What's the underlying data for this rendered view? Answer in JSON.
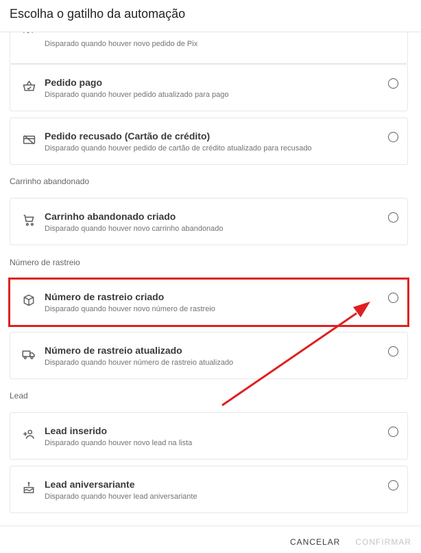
{
  "dialog": {
    "title": "Escolha o gatilho da automação"
  },
  "items": {
    "pix": {
      "description": "Disparado quando houver novo pedido de Pix"
    },
    "pedido_pago": {
      "title": "Pedido pago",
      "description": "Disparado quando houver pedido atualizado para pago"
    },
    "pedido_recusado": {
      "title": "Pedido recusado (Cartão de crédito)",
      "description": "Disparado quando houver pedido de cartão de crédito atualizado para recusado"
    },
    "carrinho_abandonado": {
      "title": "Carrinho abandonado criado",
      "description": "Disparado quando houver novo carrinho abandonado"
    },
    "rastreio_criado": {
      "title": "Número de rastreio criado",
      "description": "Disparado quando houver novo número de rastreio"
    },
    "rastreio_atualizado": {
      "title": "Número de rastreio atualizado",
      "description": "Disparado quando houver número de rastreio atualizado"
    },
    "lead_inserido": {
      "title": "Lead inserido",
      "description": "Disparado quando houver novo lead na lista"
    },
    "lead_aniversariante": {
      "title": "Lead aniversariante",
      "description": "Disparado quando houver lead aniversariante"
    }
  },
  "sections": {
    "carrinho": "Carrinho abandonado",
    "rastreio": "Número de rastreio",
    "lead": "Lead"
  },
  "actions": {
    "cancel": "CANCELAR",
    "confirm": "CONFIRMAR"
  },
  "colors": {
    "highlight": "#df2020",
    "confirm_disabled": "#c5c5c5"
  }
}
